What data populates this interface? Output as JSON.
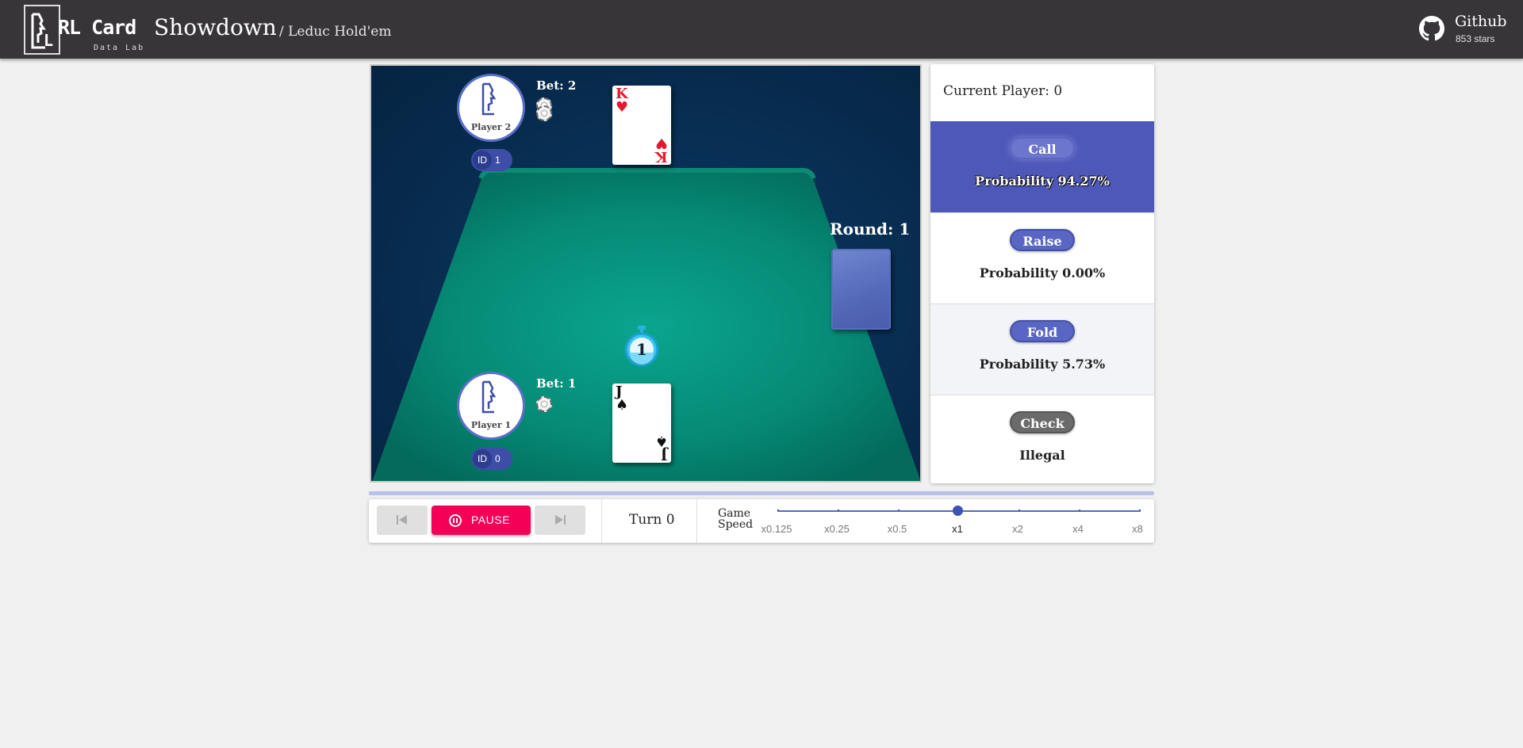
{
  "header": {
    "brand": "RL Card",
    "brand_sub": "Data Lab",
    "title": "Showdown",
    "subtitle": "/ Leduc Hold'em",
    "github_label": "Github",
    "github_stars": "853 stars"
  },
  "board": {
    "players": [
      {
        "name": "Player 2",
        "id_label": "ID",
        "id_value": "1",
        "bet": "Bet: 2",
        "card_rank": "K",
        "card_suit": "♥"
      },
      {
        "name": "Player 1",
        "id_label": "ID",
        "id_value": "0",
        "bet": "Bet: 1",
        "card_rank": "J",
        "card_suit": "♠"
      }
    ],
    "round": "Round: 1",
    "timer": "1"
  },
  "panel": {
    "current_player": "Current Player: 0",
    "actions": [
      {
        "label": "Call",
        "prob": "Probability 94.27%"
      },
      {
        "label": "Raise",
        "prob": "Probability 0.00%"
      },
      {
        "label": "Fold",
        "prob": "Probability 5.73%"
      },
      {
        "label": "Check",
        "prob": "Illegal"
      }
    ]
  },
  "controls": {
    "pause_label": "PAUSE",
    "turn": "Turn 0",
    "speed_label_1": "Game",
    "speed_label_2": "Speed",
    "speed_marks": [
      "x0.125",
      "x0.25",
      "x0.5",
      "x1",
      "x2",
      "x4",
      "x8"
    ],
    "speed_selected": "x1"
  }
}
